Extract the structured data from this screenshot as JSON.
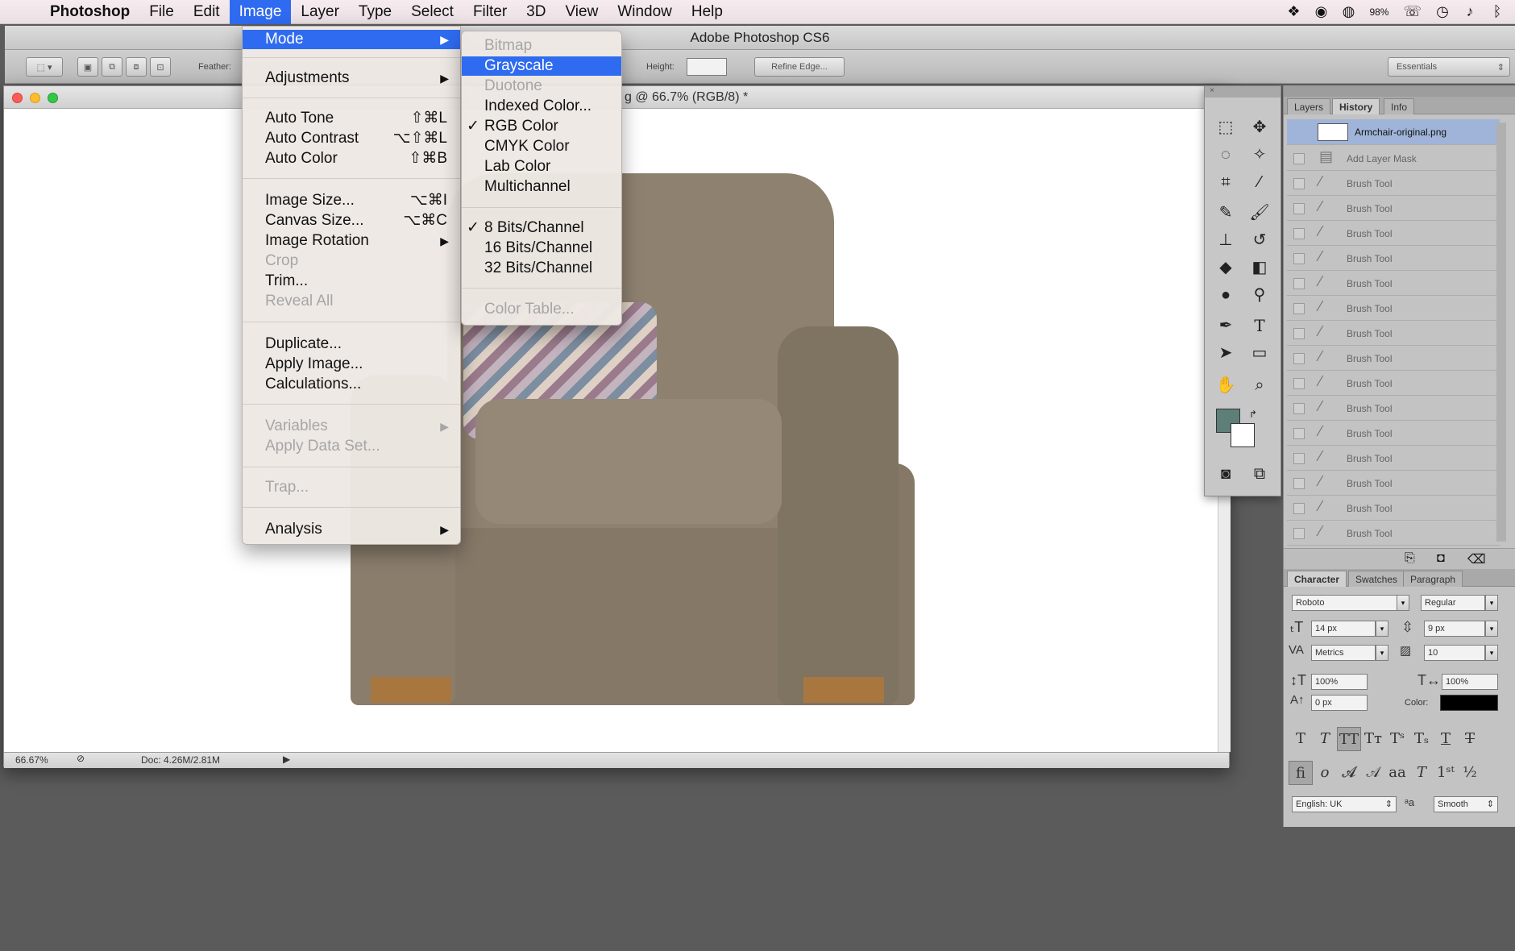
{
  "menubar": {
    "app": "Photoshop",
    "items": [
      "File",
      "Edit",
      "Image",
      "Layer",
      "Type",
      "Select",
      "Filter",
      "3D",
      "View",
      "Window",
      "Help"
    ],
    "active": "Image",
    "battery": "98%"
  },
  "app_title": "Adobe Photoshop CS6",
  "options_bar": {
    "feather_label": "Feather:",
    "height_label": "Height:",
    "refine_edge": "Refine Edge...",
    "workspace": "Essentials"
  },
  "document": {
    "title": "g @ 66.7% (RGB/8) *",
    "zoom": "66.67%",
    "doc_info": "Doc: 4.26M/2.81M"
  },
  "image_menu": {
    "mode": "Mode",
    "adjustments": "Adjustments",
    "auto_tone": "Auto Tone",
    "auto_tone_sc": "⇧⌘L",
    "auto_contrast": "Auto Contrast",
    "auto_contrast_sc": "⌥⇧⌘L",
    "auto_color": "Auto Color",
    "auto_color_sc": "⇧⌘B",
    "image_size": "Image Size...",
    "image_size_sc": "⌥⌘I",
    "canvas_size": "Canvas Size...",
    "canvas_size_sc": "⌥⌘C",
    "image_rotation": "Image Rotation",
    "crop": "Crop",
    "trim": "Trim...",
    "reveal_all": "Reveal All",
    "duplicate": "Duplicate...",
    "apply_image": "Apply Image...",
    "calculations": "Calculations...",
    "variables": "Variables",
    "apply_data_set": "Apply Data Set...",
    "trap": "Trap...",
    "analysis": "Analysis"
  },
  "mode_menu": {
    "bitmap": "Bitmap",
    "grayscale": "Grayscale",
    "duotone": "Duotone",
    "indexed": "Indexed Color...",
    "rgb": "RGB Color",
    "cmyk": "CMYK Color",
    "lab": "Lab Color",
    "multichannel": "Multichannel",
    "bits8": "8 Bits/Channel",
    "bits16": "16 Bits/Channel",
    "bits32": "32 Bits/Channel",
    "color_table": "Color Table..."
  },
  "panels": {
    "tabs": [
      "Layers",
      "History",
      "Info"
    ],
    "active_tab": "History",
    "history_snapshot": "Armchair-original.png",
    "history_items": [
      "Add Layer Mask",
      "Brush Tool",
      "Brush Tool",
      "Brush Tool",
      "Brush Tool",
      "Brush Tool",
      "Brush Tool",
      "Brush Tool",
      "Brush Tool",
      "Brush Tool",
      "Brush Tool",
      "Brush Tool",
      "Brush Tool",
      "Brush Tool",
      "Brush Tool",
      "Brush Tool"
    ],
    "char_tabs": [
      "Character",
      "Swatches",
      "Paragraph"
    ],
    "font_family": "Roboto",
    "font_style": "Regular",
    "font_size": "14 px",
    "leading": "9 px",
    "kerning": "Metrics",
    "tracking": "10",
    "vscale": "100%",
    "hscale": "100%",
    "baseline": "0 px",
    "color_label": "Color:",
    "language": "English: UK",
    "antialias": "Smooth"
  },
  "colors": {
    "foreground": "#5d7f77",
    "background": "#ffffff",
    "highlight": "#2f6bf0",
    "chair": "#8a7d6c"
  }
}
